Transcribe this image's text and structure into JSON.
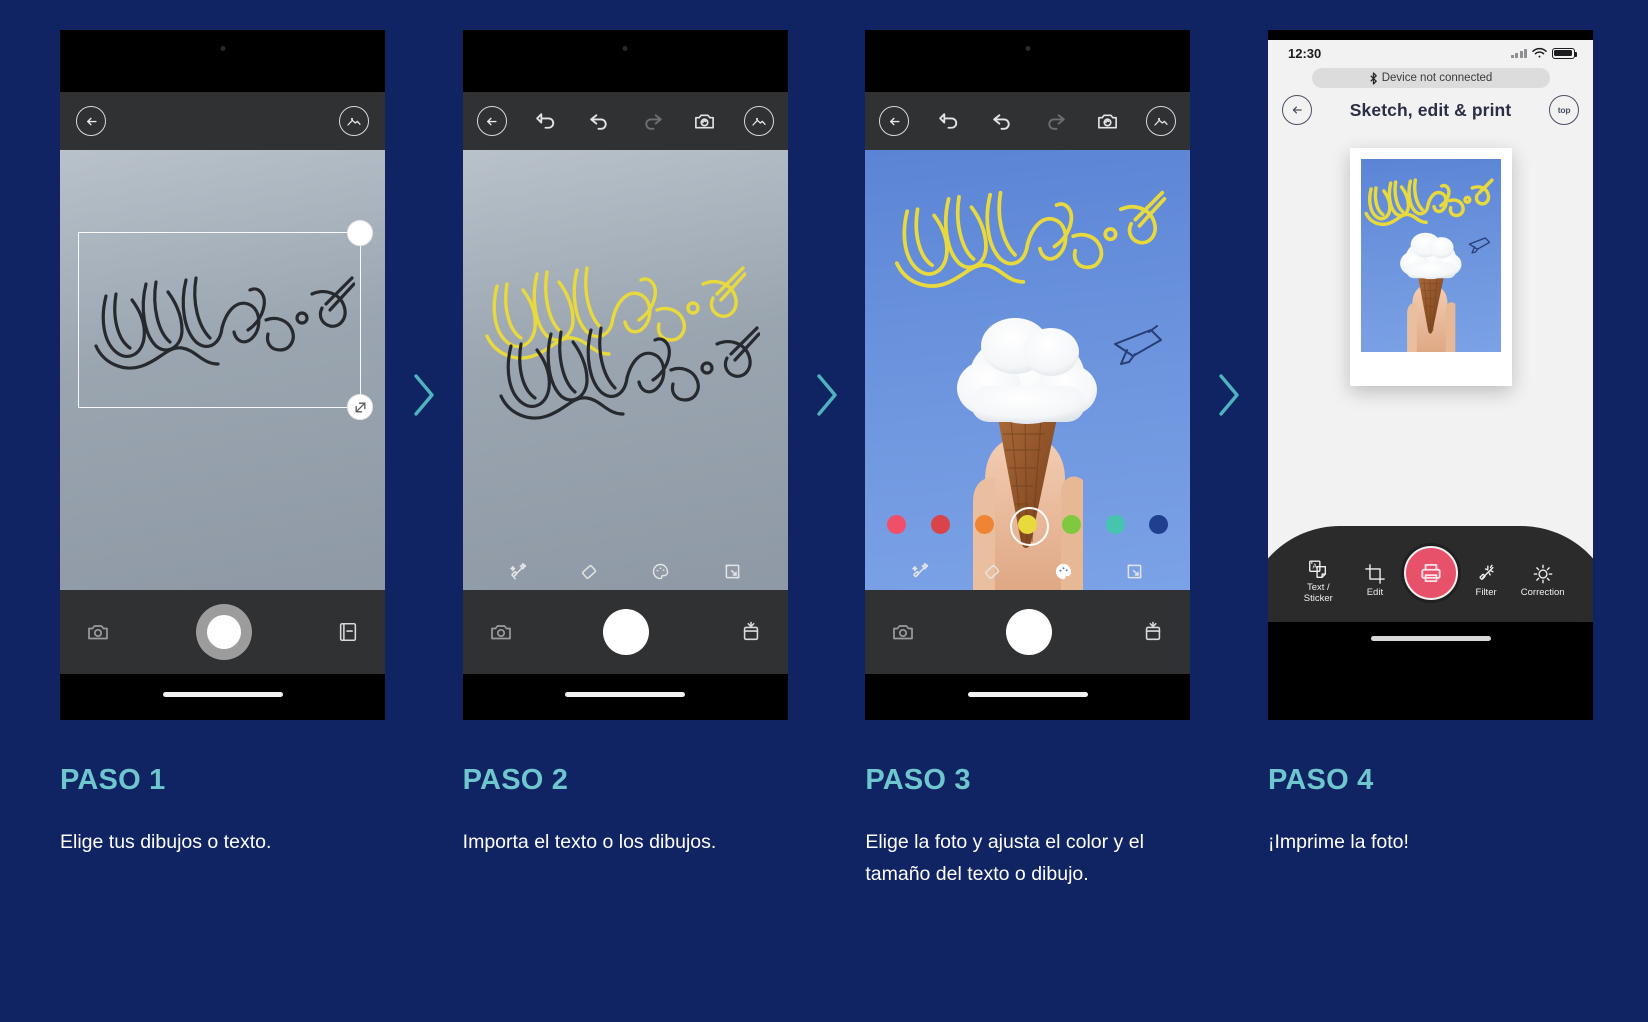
{
  "theme": {
    "background": "#102363",
    "heading_color": "#6ec6ce",
    "arrow_color": "#4fb3bf",
    "text_color": "#ffffff",
    "print_button_color": "#e8516a"
  },
  "steps": [
    {
      "heading": "PASO 1",
      "body": "Elige tus dibujos o texto.",
      "phone": {
        "screen": "camera-capture",
        "topbar_icons": [
          "back-arrow-icon",
          "gallery-icon"
        ],
        "bottombar_icons": [
          "camera-icon",
          "shutter-button",
          "album-icon"
        ],
        "selection_handles": [
          "rotate-handle",
          "resize-handle"
        ]
      }
    },
    {
      "heading": "PASO 2",
      "body": "Importa el texto o los dibujos.",
      "phone": {
        "screen": "sketch-import",
        "topbar_icons": [
          "back-arrow-icon",
          "undo-all-icon",
          "undo-icon",
          "redo-icon",
          "camera-flip-icon",
          "gallery-icon"
        ],
        "edit_tools": [
          "magic-wand-icon",
          "eraser-icon",
          "palette-icon",
          "crop-resize-icon"
        ],
        "bottombar_icons": [
          "camera-icon",
          "shutter-button",
          "save-icon"
        ]
      }
    },
    {
      "heading": "PASO 3",
      "body": "Elige la foto y ajusta el color y el tamaño del texto o dibujo.",
      "phone": {
        "screen": "color-adjust",
        "topbar_icons": [
          "back-arrow-icon",
          "undo-all-icon",
          "undo-icon",
          "redo-icon",
          "camera-flip-icon",
          "gallery-icon"
        ],
        "edit_tools": [
          "magic-wand-icon",
          "eraser-icon",
          "palette-icon",
          "crop-resize-icon"
        ],
        "bottombar_icons": [
          "camera-icon",
          "shutter-button",
          "save-icon"
        ],
        "color_swatches": [
          {
            "name": "pink",
            "hex": "#ef4f68",
            "selected": false
          },
          {
            "name": "red",
            "hex": "#d9434a",
            "selected": false
          },
          {
            "name": "orange",
            "hex": "#ef8434",
            "selected": false
          },
          {
            "name": "yellow",
            "hex": "#e8d93c",
            "selected": true
          },
          {
            "name": "green",
            "hex": "#7ec93f",
            "selected": false
          },
          {
            "name": "teal",
            "hex": "#47c4ad",
            "selected": false
          },
          {
            "name": "navy",
            "hex": "#1f3f8f",
            "selected": false
          }
        ]
      }
    },
    {
      "heading": "PASO 4",
      "body": "¡Imprime la foto!",
      "phone": {
        "screen": "print-preview",
        "status_bar": {
          "time": "12:30",
          "wifi": "wifi-icon",
          "battery": "battery-icon"
        },
        "connection_banner": {
          "icon": "bluetooth-icon",
          "text": "Device not connected"
        },
        "navbar": {
          "back": "back-arrow-icon",
          "title": "Sketch, edit & print",
          "right_button": "top"
        },
        "toolbar": [
          {
            "icon": "text-sticker-icon",
            "label": "Text /\nSticker"
          },
          {
            "icon": "crop-icon",
            "label": "Edit"
          },
          {
            "icon": "print-icon",
            "label": ""
          },
          {
            "icon": "magic-wand-icon",
            "label": "Filter"
          },
          {
            "icon": "brightness-icon",
            "label": "Correction"
          }
        ],
        "toolbar_labels": {
          "text_sticker_line1": "Text /",
          "text_sticker_line2": "Sticker",
          "edit": "Edit",
          "filter": "Filter",
          "correction": "Correction"
        }
      }
    }
  ],
  "arrows": [
    "chevron-right-icon",
    "chevron-right-icon",
    "chevron-right-icon"
  ]
}
